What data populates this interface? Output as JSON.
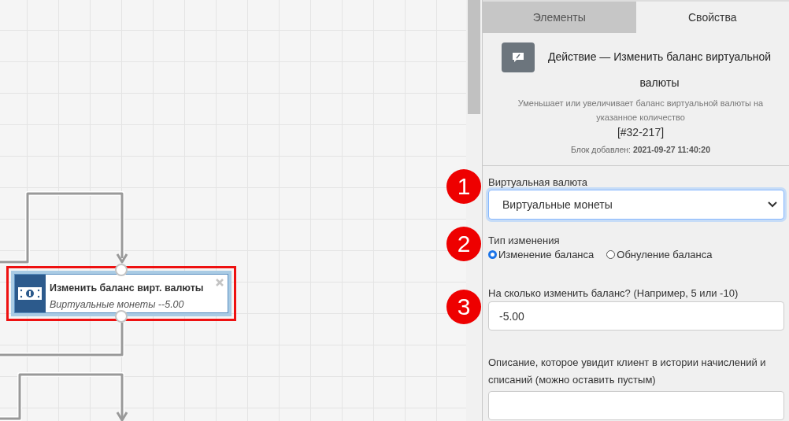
{
  "tabs": [
    {
      "label": "Элементы",
      "selected": false
    },
    {
      "label": "Свойства",
      "selected": true
    }
  ],
  "block": {
    "title": "Действие — Изменить баланс виртуальной валюты",
    "description": "Уменьшает или увеличивает баланс виртуальной валюты на указанное количество",
    "id": "[#32-217]",
    "added_label": "Блок добавлен:",
    "added_value": "2021-09-27 11:40:20"
  },
  "form": {
    "currency": {
      "label": "Виртуальная валюта",
      "value": "Виртуальные монеты"
    },
    "change_type": {
      "label": "Тип изменения",
      "options": [
        {
          "label": "Изменение баланса",
          "selected": true
        },
        {
          "label": "Обнуление баланса",
          "selected": false
        }
      ]
    },
    "amount": {
      "label": "На сколько изменить баланс? (Например, 5 или -10)",
      "value": "-5.00"
    },
    "comment": {
      "label": "Описание, которое увидит клиент в истории начислений и списаний (можно оставить пустым)"
    }
  },
  "node": {
    "title": "Изменить баланс вирт. валюты",
    "subtitle": "Виртуальные монеты --5.00",
    "selected": true
  },
  "markers": [
    "1",
    "2",
    "3"
  ]
}
